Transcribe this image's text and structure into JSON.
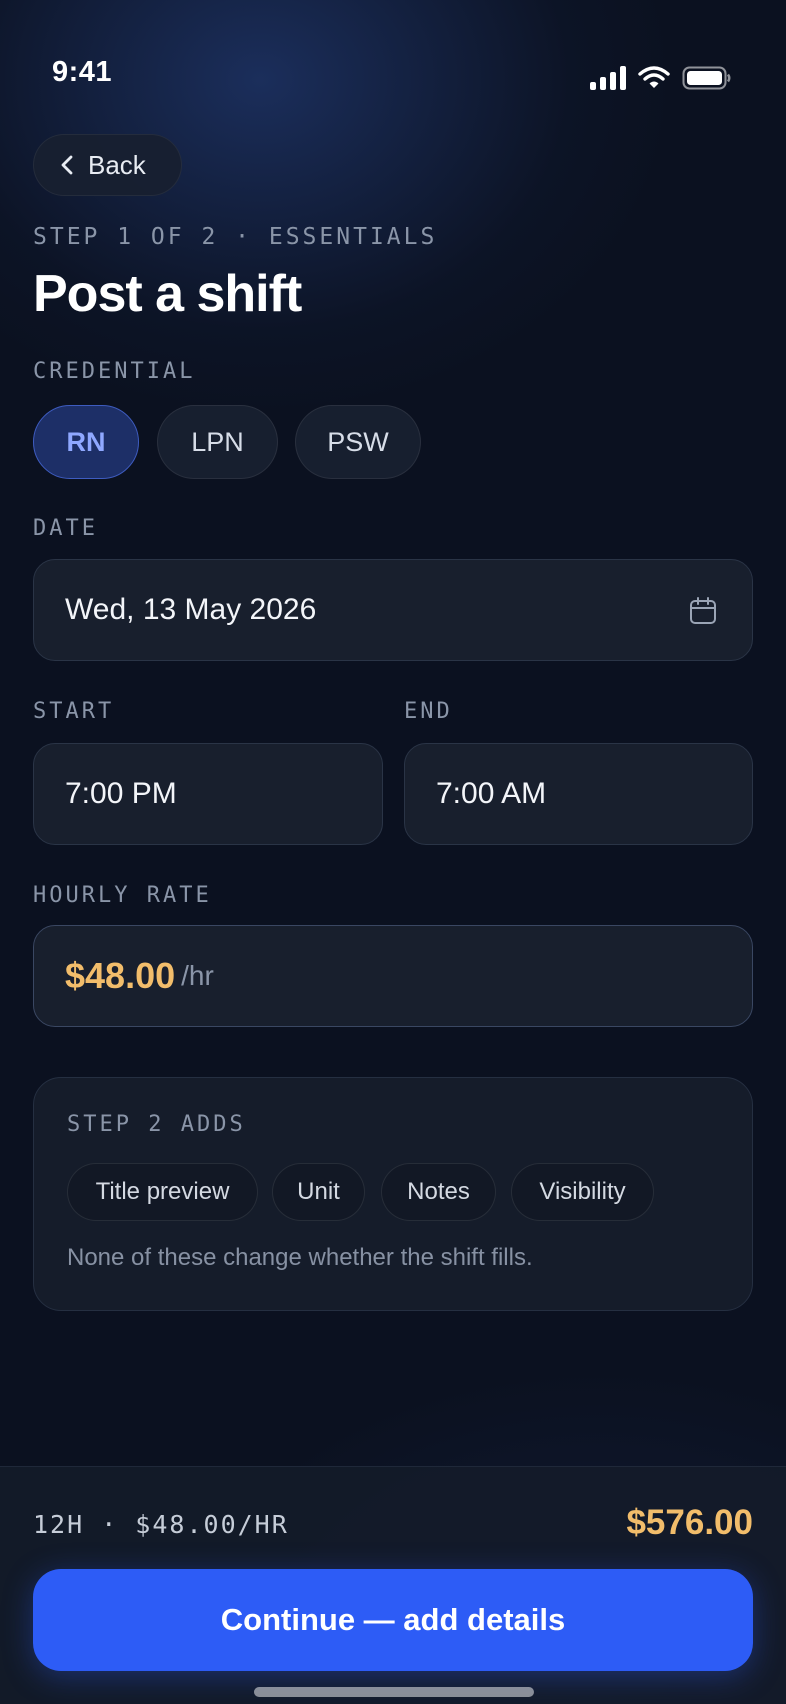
{
  "status_bar": {
    "time": "9:41"
  },
  "header": {
    "back_label": "Back",
    "step_label": "STEP 1 OF 2 · ESSENTIALS",
    "title": "Post a shift"
  },
  "credential": {
    "label": "CREDENTIAL",
    "options": [
      "RN",
      "LPN",
      "PSW"
    ],
    "selected": "RN"
  },
  "date": {
    "label": "DATE",
    "value": "Wed, 13 May 2026"
  },
  "start": {
    "label": "START",
    "value": "7:00 PM"
  },
  "end": {
    "label": "END",
    "value": "7:00 AM"
  },
  "rate": {
    "label": "HOURLY RATE",
    "amount": "$48.00",
    "unit": "/hr"
  },
  "step2": {
    "label": "STEP 2 ADDS",
    "tags": [
      "Title preview",
      "Unit",
      "Notes",
      "Visibility"
    ],
    "note": "None of these change whether the shift fills."
  },
  "footer": {
    "summary": "12H · $48.00/HR",
    "total": "$576.00",
    "cta_label": "Continue — add details"
  },
  "colors": {
    "accent": "#2d5cf6",
    "price": "#f2bd6b",
    "selected_chip_text": "#8fa8ff",
    "background": "#0b1120"
  }
}
